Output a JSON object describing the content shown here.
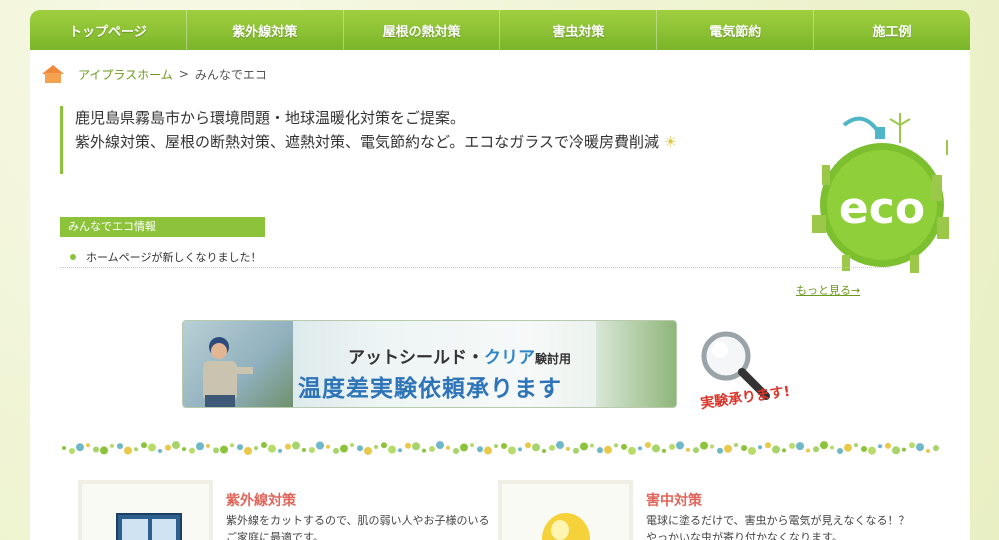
{
  "nav": {
    "items": [
      "トップページ",
      "紫外線対策",
      "屋根の熱対策",
      "害虫対策",
      "電気節約",
      "施工例"
    ]
  },
  "breadcrumb": {
    "home": "アイプラスホーム",
    "separator": ">",
    "current": "みんなでエコ"
  },
  "intro": {
    "line1": "鹿児島県霧島市から環境問題・地球温暖化対策をご提案。",
    "line2": "紫外線対策、屋根の断熱対策、遮熱対策、電気節約など。エコなガラスで冷暖房費削減"
  },
  "eco_logo": {
    "text": "eco"
  },
  "news": {
    "heading": "みんなでエコ情報",
    "items": [
      "ホームページが新しくなりました！"
    ],
    "more": "もっと見る→"
  },
  "banner": {
    "line1_a": "アットシールド・",
    "line1_b": "クリア",
    "line1_c": "験討用",
    "line2": "温度差実験依頼承ります"
  },
  "magnifier": {
    "text": "実験承ります!"
  },
  "cards": [
    {
      "title": "紫外線対策",
      "text": "紫外線をカットするので、肌の弱い人やお子様のいるご家庭に最適です。"
    },
    {
      "title": "害中対策",
      "text": "電球に塗るだけで、害虫から電気が見えなくなる！？やっかいな虫が寄り付かなくなります。"
    }
  ],
  "colors": {
    "nav_green": "#8cc33a",
    "accent_red": "#e0655a",
    "link_green": "#6b9a1e",
    "banner_blue": "#2d74b8"
  }
}
